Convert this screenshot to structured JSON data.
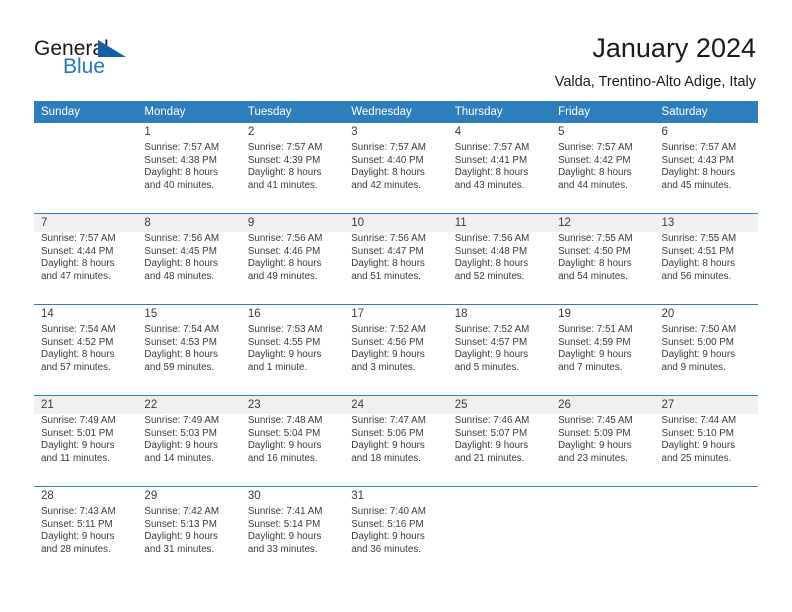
{
  "brand": {
    "name_part1": "General",
    "name_part2": "Blue",
    "flag_icon": "blue-triangle-flag-icon",
    "accent_color": "#1f77c2"
  },
  "header": {
    "title": "January 2024",
    "subtitle": "Valda, Trentino-Alto Adige, Italy"
  },
  "theme": {
    "header_bg": "#2e7ebc",
    "row_divider": "#2e7ebc",
    "shaded_row_bg": "#f0f0f0",
    "text_color": "#3b3b3b"
  },
  "calendar": {
    "weekday_headers": [
      "Sunday",
      "Monday",
      "Tuesday",
      "Wednesday",
      "Thursday",
      "Friday",
      "Saturday"
    ],
    "weeks": [
      {
        "shaded": false,
        "days": [
          {
            "day": "",
            "lines": []
          },
          {
            "day": "1",
            "lines": [
              "Sunrise: 7:57 AM",
              "Sunset: 4:38 PM",
              "Daylight: 8 hours",
              "and 40 minutes."
            ]
          },
          {
            "day": "2",
            "lines": [
              "Sunrise: 7:57 AM",
              "Sunset: 4:39 PM",
              "Daylight: 8 hours",
              "and 41 minutes."
            ]
          },
          {
            "day": "3",
            "lines": [
              "Sunrise: 7:57 AM",
              "Sunset: 4:40 PM",
              "Daylight: 8 hours",
              "and 42 minutes."
            ]
          },
          {
            "day": "4",
            "lines": [
              "Sunrise: 7:57 AM",
              "Sunset: 4:41 PM",
              "Daylight: 8 hours",
              "and 43 minutes."
            ]
          },
          {
            "day": "5",
            "lines": [
              "Sunrise: 7:57 AM",
              "Sunset: 4:42 PM",
              "Daylight: 8 hours",
              "and 44 minutes."
            ]
          },
          {
            "day": "6",
            "lines": [
              "Sunrise: 7:57 AM",
              "Sunset: 4:43 PM",
              "Daylight: 8 hours",
              "and 45 minutes."
            ]
          }
        ]
      },
      {
        "shaded": true,
        "days": [
          {
            "day": "7",
            "lines": [
              "Sunrise: 7:57 AM",
              "Sunset: 4:44 PM",
              "Daylight: 8 hours",
              "and 47 minutes."
            ]
          },
          {
            "day": "8",
            "lines": [
              "Sunrise: 7:56 AM",
              "Sunset: 4:45 PM",
              "Daylight: 8 hours",
              "and 48 minutes."
            ]
          },
          {
            "day": "9",
            "lines": [
              "Sunrise: 7:56 AM",
              "Sunset: 4:46 PM",
              "Daylight: 8 hours",
              "and 49 minutes."
            ]
          },
          {
            "day": "10",
            "lines": [
              "Sunrise: 7:56 AM",
              "Sunset: 4:47 PM",
              "Daylight: 8 hours",
              "and 51 minutes."
            ]
          },
          {
            "day": "11",
            "lines": [
              "Sunrise: 7:56 AM",
              "Sunset: 4:48 PM",
              "Daylight: 8 hours",
              "and 52 minutes."
            ]
          },
          {
            "day": "12",
            "lines": [
              "Sunrise: 7:55 AM",
              "Sunset: 4:50 PM",
              "Daylight: 8 hours",
              "and 54 minutes."
            ]
          },
          {
            "day": "13",
            "lines": [
              "Sunrise: 7:55 AM",
              "Sunset: 4:51 PM",
              "Daylight: 8 hours",
              "and 56 minutes."
            ]
          }
        ]
      },
      {
        "shaded": false,
        "days": [
          {
            "day": "14",
            "lines": [
              "Sunrise: 7:54 AM",
              "Sunset: 4:52 PM",
              "Daylight: 8 hours",
              "and 57 minutes."
            ]
          },
          {
            "day": "15",
            "lines": [
              "Sunrise: 7:54 AM",
              "Sunset: 4:53 PM",
              "Daylight: 8 hours",
              "and 59 minutes."
            ]
          },
          {
            "day": "16",
            "lines": [
              "Sunrise: 7:53 AM",
              "Sunset: 4:55 PM",
              "Daylight: 9 hours",
              "and 1 minute."
            ]
          },
          {
            "day": "17",
            "lines": [
              "Sunrise: 7:52 AM",
              "Sunset: 4:56 PM",
              "Daylight: 9 hours",
              "and 3 minutes."
            ]
          },
          {
            "day": "18",
            "lines": [
              "Sunrise: 7:52 AM",
              "Sunset: 4:57 PM",
              "Daylight: 9 hours",
              "and 5 minutes."
            ]
          },
          {
            "day": "19",
            "lines": [
              "Sunrise: 7:51 AM",
              "Sunset: 4:59 PM",
              "Daylight: 9 hours",
              "and 7 minutes."
            ]
          },
          {
            "day": "20",
            "lines": [
              "Sunrise: 7:50 AM",
              "Sunset: 5:00 PM",
              "Daylight: 9 hours",
              "and 9 minutes."
            ]
          }
        ]
      },
      {
        "shaded": true,
        "days": [
          {
            "day": "21",
            "lines": [
              "Sunrise: 7:49 AM",
              "Sunset: 5:01 PM",
              "Daylight: 9 hours",
              "and 11 minutes."
            ]
          },
          {
            "day": "22",
            "lines": [
              "Sunrise: 7:49 AM",
              "Sunset: 5:03 PM",
              "Daylight: 9 hours",
              "and 14 minutes."
            ]
          },
          {
            "day": "23",
            "lines": [
              "Sunrise: 7:48 AM",
              "Sunset: 5:04 PM",
              "Daylight: 9 hours",
              "and 16 minutes."
            ]
          },
          {
            "day": "24",
            "lines": [
              "Sunrise: 7:47 AM",
              "Sunset: 5:06 PM",
              "Daylight: 9 hours",
              "and 18 minutes."
            ]
          },
          {
            "day": "25",
            "lines": [
              "Sunrise: 7:46 AM",
              "Sunset: 5:07 PM",
              "Daylight: 9 hours",
              "and 21 minutes."
            ]
          },
          {
            "day": "26",
            "lines": [
              "Sunrise: 7:45 AM",
              "Sunset: 5:09 PM",
              "Daylight: 9 hours",
              "and 23 minutes."
            ]
          },
          {
            "day": "27",
            "lines": [
              "Sunrise: 7:44 AM",
              "Sunset: 5:10 PM",
              "Daylight: 9 hours",
              "and 25 minutes."
            ]
          }
        ]
      },
      {
        "shaded": false,
        "days": [
          {
            "day": "28",
            "lines": [
              "Sunrise: 7:43 AM",
              "Sunset: 5:11 PM",
              "Daylight: 9 hours",
              "and 28 minutes."
            ]
          },
          {
            "day": "29",
            "lines": [
              "Sunrise: 7:42 AM",
              "Sunset: 5:13 PM",
              "Daylight: 9 hours",
              "and 31 minutes."
            ]
          },
          {
            "day": "30",
            "lines": [
              "Sunrise: 7:41 AM",
              "Sunset: 5:14 PM",
              "Daylight: 9 hours",
              "and 33 minutes."
            ]
          },
          {
            "day": "31",
            "lines": [
              "Sunrise: 7:40 AM",
              "Sunset: 5:16 PM",
              "Daylight: 9 hours",
              "and 36 minutes."
            ]
          },
          {
            "day": "",
            "lines": []
          },
          {
            "day": "",
            "lines": []
          },
          {
            "day": "",
            "lines": []
          }
        ]
      }
    ]
  }
}
